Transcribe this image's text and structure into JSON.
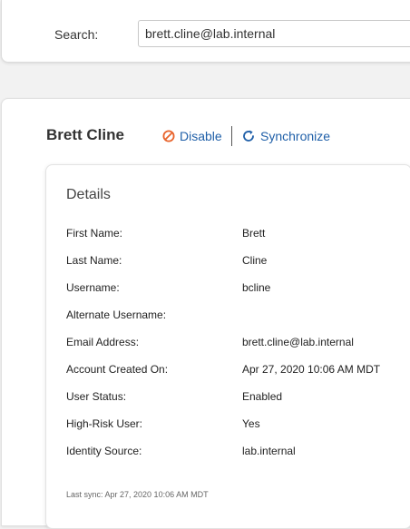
{
  "search": {
    "label": "Search:",
    "value": "brett.cline@lab.internal"
  },
  "user": {
    "name": "Brett Cline",
    "actions": {
      "disable_label": "Disable",
      "disable_icon": "disable-icon",
      "synchronize_label": "Synchronize",
      "synchronize_icon": "sync-icon"
    }
  },
  "details": {
    "title": "Details",
    "rows": [
      {
        "label": "First Name:",
        "value": "Brett"
      },
      {
        "label": "Last Name:",
        "value": "Cline"
      },
      {
        "label": "Username:",
        "value": "bcline"
      },
      {
        "label": "Alternate Username:",
        "value": ""
      },
      {
        "label": "Email Address:",
        "value": "brett.cline@lab.internal"
      },
      {
        "label": "Account Created On:",
        "value": "Apr 27, 2020 10:06 AM MDT"
      },
      {
        "label": "User Status:",
        "value": "Enabled"
      },
      {
        "label": "High-Risk User:",
        "value": "Yes"
      },
      {
        "label": "Identity Source:",
        "value": "lab.internal"
      }
    ],
    "last_sync": "Last sync: Apr 27, 2020 10:06 AM MDT"
  },
  "colors": {
    "link": "#1f5fa8",
    "disable_icon": "#e8632b"
  }
}
